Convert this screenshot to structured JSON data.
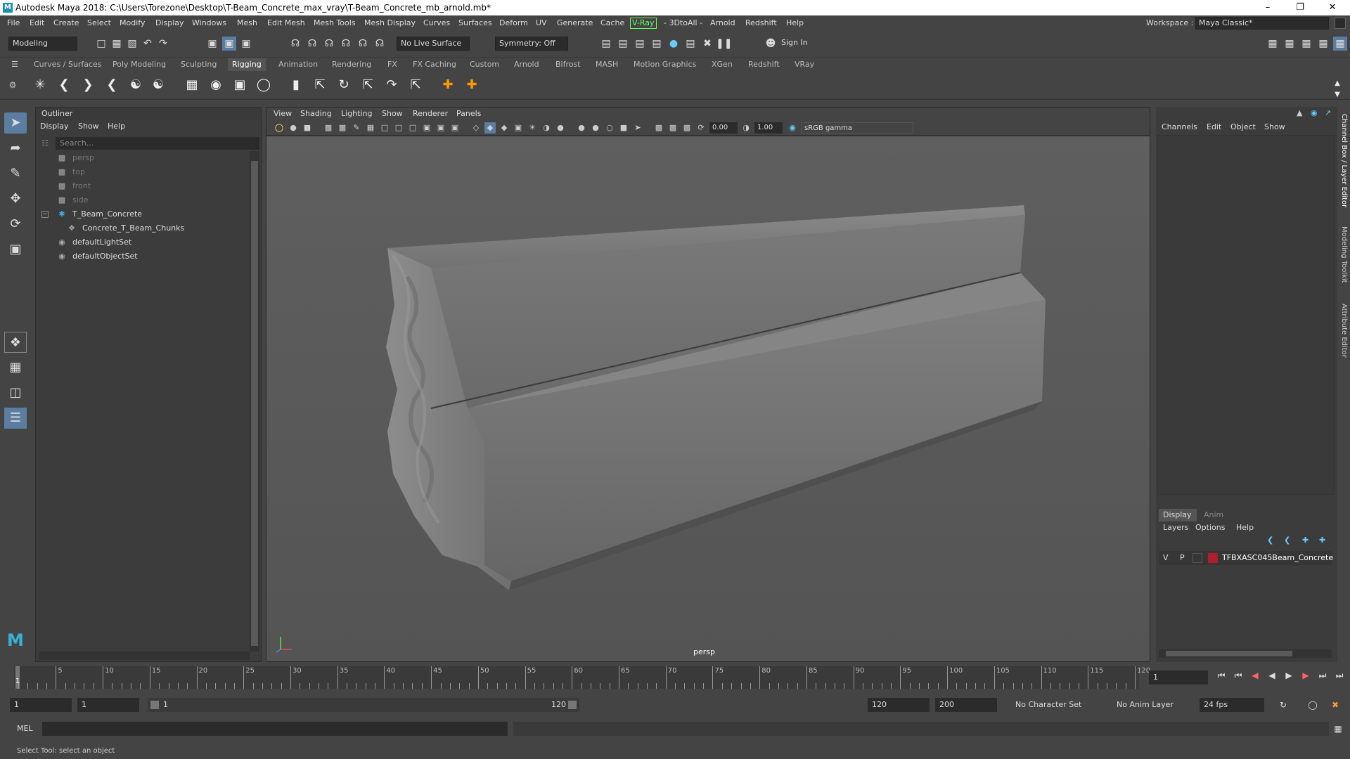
{
  "window": {
    "title": "Autodesk Maya 2018: C:\\Users\\Torezone\\Desktop\\T-Beam_Concrete_max_vray\\T-Beam_Concrete_mb_arnold.mb*"
  },
  "menubar": {
    "items": [
      "File",
      "Edit",
      "Create",
      "Select",
      "Modify",
      "Display",
      "Windows",
      "Mesh",
      "Edit Mesh",
      "Mesh Tools",
      "Mesh Display",
      "Curves",
      "Surfaces",
      "Deform",
      "UV",
      "Generate",
      "Cache",
      "V-Ray",
      "- 3DtoAll -",
      "Arnold",
      "Redshift",
      "Help"
    ],
    "workspace_label": "Workspace :",
    "workspace_value": "Maya Classic*"
  },
  "statusline": {
    "mode": "Modeling",
    "live_surface": "No Live Surface",
    "symmetry": "Symmetry: Off",
    "sign_in": "Sign In"
  },
  "shelf": {
    "tabs": [
      "Curves / Surfaces",
      "Poly Modeling",
      "Sculpting",
      "Rigging",
      "Animation",
      "Rendering",
      "FX",
      "FX Caching",
      "Custom",
      "Arnold",
      "Bifrost",
      "MASH",
      "Motion Graphics",
      "XGen",
      "Redshift",
      "VRay"
    ],
    "active_tab": "Rigging"
  },
  "outliner": {
    "title": "Outliner",
    "menu": [
      "Display",
      "Show",
      "Help"
    ],
    "search_placeholder": "Search...",
    "items": [
      {
        "label": "persp",
        "icon": "camera-icon"
      },
      {
        "label": "top",
        "icon": "camera-icon"
      },
      {
        "label": "front",
        "icon": "camera-icon"
      },
      {
        "label": "side",
        "icon": "camera-icon"
      },
      {
        "label": "T_Beam_Concrete",
        "icon": "group-icon"
      },
      {
        "label": "Concrete_T_Beam_Chunks",
        "icon": "mesh-icon"
      },
      {
        "label": "defaultLightSet",
        "icon": "set-icon"
      },
      {
        "label": "defaultObjectSet",
        "icon": "set-icon"
      }
    ]
  },
  "viewport": {
    "menu": [
      "View",
      "Shading",
      "Lighting",
      "Show",
      "Renderer",
      "Panels"
    ],
    "exposure": "0.00",
    "gamma": "1.00",
    "color_space": "sRGB gamma",
    "camera": "persp"
  },
  "channelbox": {
    "menu": [
      "Channels",
      "Edit",
      "Object",
      "Show"
    ]
  },
  "layers": {
    "tabs": [
      "Display",
      "Anim"
    ],
    "menu": [
      "Layers",
      "Options",
      "Help"
    ],
    "row": {
      "v": "V",
      "p": "P",
      "name": "TFBXASC045Beam_Concrete",
      "color": "#b01e2e"
    }
  },
  "sidetabs": [
    "Channel Box / Layer Editor",
    "Modeling Toolkit",
    "Attribute Editor"
  ],
  "timeline": {
    "labels": [
      "5",
      "10",
      "15",
      "20",
      "25",
      "30",
      "35",
      "40",
      "45",
      "50",
      "55",
      "60",
      "65",
      "70",
      "75",
      "80",
      "85",
      "90",
      "95",
      "100",
      "105",
      "110",
      "115",
      "120"
    ],
    "current_frame": "1",
    "frame_field": "1"
  },
  "range": {
    "start": "1",
    "playback_start": "1",
    "slider_start": "1",
    "slider_end": "120",
    "playback_end": "120",
    "end": "200",
    "character_set": "No Character Set",
    "anim_layer": "No Anim Layer",
    "fps": "24 fps"
  },
  "cmdline": {
    "label": "MEL"
  },
  "helpline": {
    "text": "Select Tool: select an object"
  }
}
